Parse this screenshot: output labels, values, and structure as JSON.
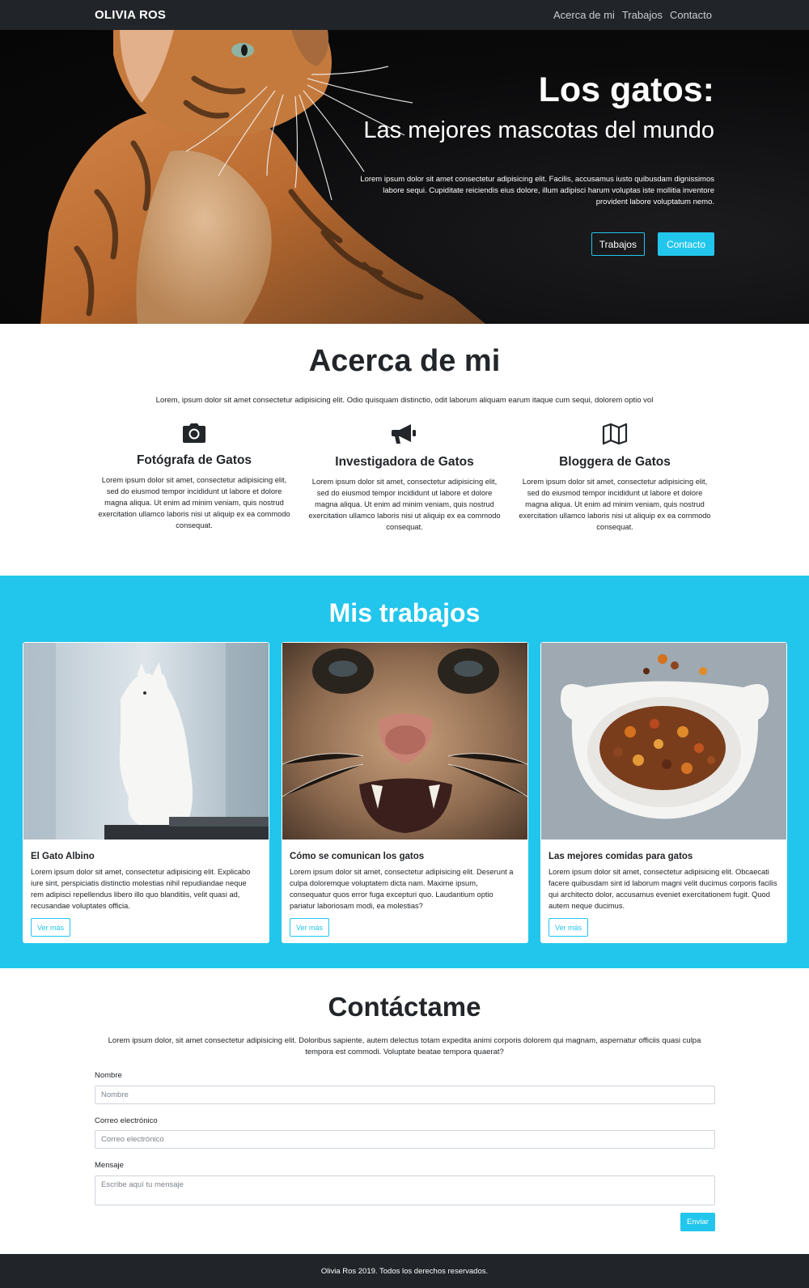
{
  "nav": {
    "brand": "OLIVIA ROS",
    "links": [
      "Acerca de mi",
      "Trabajos",
      "Contacto"
    ]
  },
  "hero": {
    "title": "Los gatos:",
    "subtitle": "Las mejores mascotas del mundo",
    "text": "Lorem ipsum dolor sit amet consectetur adipisicing elit. Facilis, accusamus iusto quibusdam dignissimos labore sequi. Cupiditate reiciendis eius dolore, illum adipisci harum voluptas iste mollitia inventore provident labore voluptatum nemo.",
    "buttons": [
      "Trabajos",
      "Contacto"
    ]
  },
  "about": {
    "title": "Acerca de mi",
    "intro": "Lorem, ipsum dolor sit amet consectetur adipisicing elit. Odio quisquam distinctio, odit laborum aliquam earum itaque cum sequi, dolorem optio vol",
    "features": [
      {
        "icon": "camera-icon",
        "title": "Fotógrafa de Gatos",
        "text": "Lorem ipsum dolor sit amet, consectetur adipisicing elit, sed do eiusmod tempor incididunt ut labore et dolore magna aliqua. Ut enim ad minim veniam, quis nostrud exercitation ullamco laboris nisi ut aliquip ex ea commodo consequat."
      },
      {
        "icon": "megaphone-icon",
        "title": "Investigadora de Gatos",
        "text": "Lorem ipsum dolor sit amet, consectetur adipisicing elit, sed do eiusmod tempor incididunt ut labore et dolore magna aliqua. Ut enim ad minim veniam, quis nostrud exercitation ullamco laboris nisi ut aliquip ex ea commodo consequat."
      },
      {
        "icon": "map-icon",
        "title": "Bloggera de Gatos",
        "text": "Lorem ipsum dolor sit amet, consectetur adipisicing elit, sed do eiusmod tempor incididunt ut labore et dolore magna aliqua. Ut enim ad minim veniam, quis nostrud exercitation ullamco laboris nisi ut aliquip ex ea commodo consequat."
      }
    ]
  },
  "works": {
    "title": "Mis trabajos",
    "cards": [
      {
        "image": "white-cat-photo",
        "title": "El Gato Albino",
        "text": "Lorem ipsum dolor sit amet, consectetur adipisicing elit. Explicabo iure sint, perspiciatis distinctio molestias nihil repudiandae neque rem adipisci repellendus libero illo quo blanditiis, velit quasi ad, recusandae voluptates officia.",
        "button": "Ver más"
      },
      {
        "image": "cat-closeup-photo",
        "title": "Cómo se comunican los gatos",
        "text": "Lorem ipsum dolor sit amet, consectetur adipisicing elit. Deserunt a culpa doloremque voluptatem dicta nam. Maxime ipsum, consequatur quos error fuga excepturi quo. Laudantium optio pariatur laboriosam modi, ea molestias?",
        "button": "Ver más"
      },
      {
        "image": "cat-food-bowl-photo",
        "title": "Las mejores comidas para gatos",
        "text": "Lorem ipsum dolor sit amet, consectetur adipisicing elit. Obcaecati facere quibusdam sint id laborum magni velit ducimus corporis facilis qui architecto dolor, accusamus eveniet exercitationem fugit. Quod autem neque ducimus.",
        "button": "Ver más"
      }
    ]
  },
  "contact": {
    "title": "Contáctame",
    "intro": "Lorem ipsum dolor, sit amet consectetur adipisicing elit. Doloribus sapiente, autem delectus totam expedita animi corporis dolorem qui magnam, aspernatur officiis quasi culpa tempora est commodi. Voluptate beatae tempora quaerat?",
    "name_label": "Nombre",
    "name_placeholder": "Nombre",
    "email_label": "Correo electrónico",
    "email_placeholder": "Correo electrónico",
    "message_label": "Mensaje",
    "message_placeholder": "Escribe aquí tu mensaje",
    "submit": "Enviar"
  },
  "footer": {
    "text": "Olivia Ros 2019. Todos los derechos reservados."
  },
  "colors": {
    "accent": "#22c6ec",
    "dark": "#212529",
    "text": "#222529"
  }
}
